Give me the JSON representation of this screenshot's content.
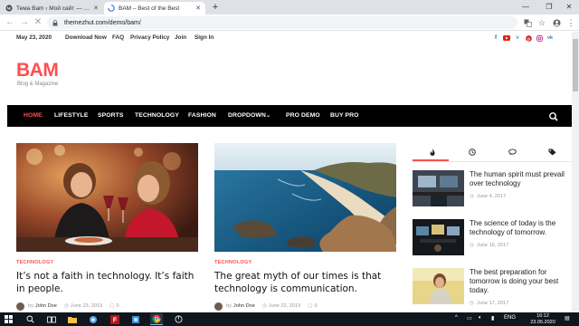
{
  "browser": {
    "tabs": [
      {
        "title": "Тема Bam ‹ Мой сайт — WordPress",
        "active": false
      },
      {
        "title": "BAM – Best of the Best",
        "active": true
      }
    ],
    "url": "themezhut.com/demo/bam/"
  },
  "site": {
    "top_date": "May 23, 2020",
    "top_links": [
      "Download Now",
      "FAQ",
      "Privacy Policy",
      "Join",
      "Sign In"
    ],
    "social_icons": [
      "facebook-icon",
      "youtube-icon",
      "vimeo-icon",
      "pinterest-icon",
      "instagram-icon",
      "vk-icon"
    ],
    "logo": "BAM",
    "tagline": "Blog & Magazine",
    "nav": [
      "HOME",
      "LIFESTYLE",
      "SPORTS",
      "TECHNOLOGY",
      "FASHION",
      "DROPDOWN",
      "PRO DEMO",
      "BUY PRO"
    ],
    "accent_color": "#ff4f4f",
    "posts": [
      {
        "category": "TECHNOLOGY",
        "title": "It’s not a faith in technology. It’s faith in people.",
        "author_prefix": "by",
        "author": "John Doe",
        "date": "June 23, 2019",
        "comments": "0"
      },
      {
        "category": "TECHNOLOGY",
        "title": "The great myth of our times is that technology is communication.",
        "author_prefix": "by",
        "author": "John Doe",
        "date": "June 22, 2019",
        "comments": "0"
      }
    ],
    "sidebar_tabs": [
      "fire-icon",
      "clock-icon",
      "comments-icon",
      "tag-icon"
    ],
    "sidebar_posts": [
      {
        "title": "The human spirit must prevail over technology",
        "date": "June 4, 2017"
      },
      {
        "title": "The science of today is the technology of tomorrow.",
        "date": "June 16, 2017"
      },
      {
        "title": "The best preparation for tomorrow is doing your best today.",
        "date": "June 17, 2017"
      }
    ]
  },
  "taskbar": {
    "lang": "ENG",
    "time": "16:12",
    "date": "23.05.2020"
  }
}
